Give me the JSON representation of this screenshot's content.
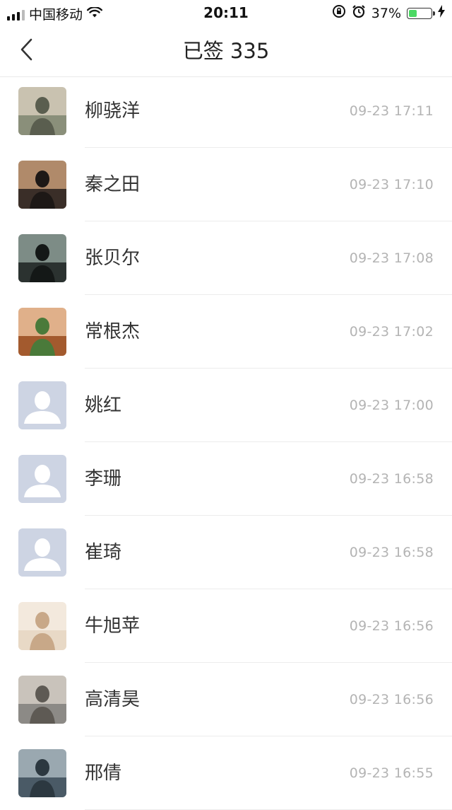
{
  "status_bar": {
    "carrier": "中国移动",
    "time": "20:11",
    "battery_percent": "37%",
    "battery_level": 0.37,
    "icons": [
      "signal-icon",
      "wifi-icon",
      "orientation-lock-icon",
      "alarm-icon",
      "battery-icon",
      "charging-icon"
    ]
  },
  "nav": {
    "title": "已签 335",
    "back_icon": "chevron-left-icon"
  },
  "colors": {
    "divider": "#ececec",
    "time_text": "#b4b4b4",
    "placeholder_avatar_bg": "#cdd4e3",
    "battery_fill": "#4cd964"
  },
  "list": [
    {
      "name": "柳骁洋",
      "time": "09-23 17:11",
      "avatar": "photo"
    },
    {
      "name": "秦之田",
      "time": "09-23 17:10",
      "avatar": "photo"
    },
    {
      "name": "张贝尔",
      "time": "09-23 17:08",
      "avatar": "photo"
    },
    {
      "name": "常根杰",
      "time": "09-23 17:02",
      "avatar": "photo"
    },
    {
      "name": "姚红",
      "time": "09-23 17:00",
      "avatar": "placeholder"
    },
    {
      "name": "李珊",
      "time": "09-23 16:58",
      "avatar": "placeholder"
    },
    {
      "name": "崔琦",
      "time": "09-23 16:58",
      "avatar": "placeholder"
    },
    {
      "name": "牛旭苹",
      "time": "09-23 16:56",
      "avatar": "photo"
    },
    {
      "name": "高清昊",
      "time": "09-23 16:56",
      "avatar": "photo"
    },
    {
      "name": "邢倩",
      "time": "09-23 16:55",
      "avatar": "photo"
    }
  ]
}
